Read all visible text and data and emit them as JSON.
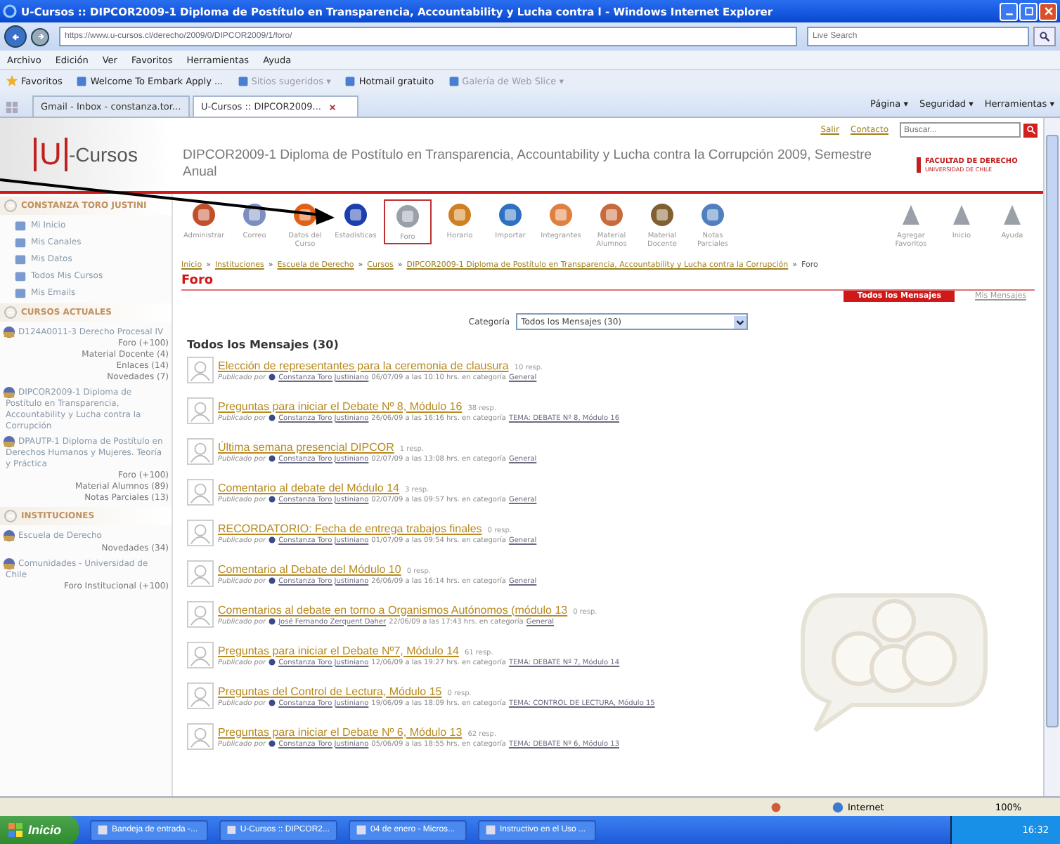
{
  "window": {
    "title": "U-Cursos :: DIPCOR2009-1 Diploma de Postítulo en Transparencia, Accountability y Lucha contra l - Windows Internet Explorer"
  },
  "browser": {
    "address": "https://www.u-cursos.cl/derecho/2009/0/DIPCOR2009/1/foro/",
    "search_placeholder": "Live Search",
    "menu": [
      "Archivo",
      "Edición",
      "Ver",
      "Favoritos",
      "Herramientas",
      "Ayuda"
    ],
    "favorites_label": "Favoritos",
    "favorites": [
      "Welcome To Embark Apply ...",
      "Sitios sugeridos ▾",
      "Hotmail gratuito",
      "Galería de Web Slice ▾"
    ],
    "tabs": [
      {
        "label": "Gmail - Inbox - constanza.tor...",
        "selected": false
      },
      {
        "label": "U-Cursos :: DIPCOR2009...",
        "selected": true
      }
    ],
    "commands": [
      "Página ▾",
      "Seguridad ▾",
      "Herramientas ▾"
    ]
  },
  "header": {
    "logo_letter": "U",
    "logo_text": "-Cursos",
    "links": [
      "Salir",
      "Contacto"
    ],
    "search_placeholder": "Buscar...",
    "course_title": "DIPCOR2009-1 Diploma de Postítulo en Transparencia, Accountability y Lucha contra la Corrupción 2009, Semestre Anual",
    "faculty": "FACULTAD DE DERECHO",
    "university": "UNIVERSIDAD DE CHILE"
  },
  "sidebar": {
    "sections": [
      {
        "title": "CONSTANZA TORO JUSTINI",
        "items": [
          {
            "kind": "link",
            "label": "Mi Inicio"
          },
          {
            "kind": "link",
            "label": "Mis Canales"
          },
          {
            "kind": "link",
            "label": "Mis Datos"
          },
          {
            "kind": "link",
            "label": "Todos Mis Cursos"
          },
          {
            "kind": "link",
            "label": "Mis Emails"
          }
        ]
      },
      {
        "title": "CURSOS ACTUALES",
        "items": [
          {
            "kind": "course",
            "label": "D124A0011-3 Derecho Procesal IV"
          },
          {
            "kind": "sub",
            "label": "Foro (+100)"
          },
          {
            "kind": "sub",
            "label": "Material Docente (4)"
          },
          {
            "kind": "sub",
            "label": "Enlaces (14)"
          },
          {
            "kind": "sub",
            "label": "Novedades (7)"
          },
          {
            "kind": "course",
            "label": "DIPCOR2009-1 Diploma de Postítulo en Transparencia, Accountability y Lucha contra la Corrupción"
          },
          {
            "kind": "course",
            "label": "DPAUTP-1 Diploma de Postítulo en Derechos Humanos y Mujeres. Teoría y Práctica"
          },
          {
            "kind": "sub",
            "label": "Foro (+100)"
          },
          {
            "kind": "sub",
            "label": "Material Alumnos (89)"
          },
          {
            "kind": "sub",
            "label": "Notas Parciales (13)"
          }
        ]
      },
      {
        "title": "INSTITUCIONES",
        "items": [
          {
            "kind": "course",
            "label": "Escuela de Derecho"
          },
          {
            "kind": "sub",
            "label": "Novedades (34)"
          },
          {
            "kind": "course",
            "label": "Comunidades - Universidad de Chile"
          },
          {
            "kind": "sub",
            "label": "Foro Institucional (+100)"
          }
        ]
      }
    ]
  },
  "tools": [
    {
      "label": "Administrar",
      "selected": false
    },
    {
      "label": "Correo",
      "selected": false
    },
    {
      "label": "Datos del Curso",
      "selected": false
    },
    {
      "label": "Estadísticas",
      "selected": false
    },
    {
      "label": "Foro",
      "selected": true
    },
    {
      "label": "Horario",
      "selected": false
    },
    {
      "label": "Importar",
      "selected": false
    },
    {
      "label": "Integrantes",
      "selected": false
    },
    {
      "label": "Material Alumnos",
      "selected": false
    },
    {
      "label": "Material Docente",
      "selected": false
    },
    {
      "label": "Notas Parciales",
      "selected": false
    }
  ],
  "right_tools": [
    "Agregar Favoritos",
    "Inicio",
    "Ayuda"
  ],
  "breadcrumb": {
    "separator": "»",
    "links": [
      "Inicio",
      "Instituciones",
      "Escuela de Derecho",
      "Cursos",
      "DIPCOR2009-1 Diploma de Postítulo en Transparencia, Accountability y Lucha contra la Corrupción"
    ],
    "current": "Foro"
  },
  "forum": {
    "title": "Foro",
    "tabs": [
      {
        "label": "Todos los Mensajes",
        "selected": true
      },
      {
        "label": "Mis Mensajes",
        "selected": false
      }
    ],
    "category_label": "Categoría",
    "category_value": "Todos los Mensajes (30)",
    "heading": "Todos los Mensajes (30)",
    "posts": [
      {
        "title": "Elección de representantes para la ceremonia de clausura",
        "replies": "10 resp.",
        "by": "Publicado por",
        "author": "Constanza Toro Justiniano",
        "when": "06/07/09 a las 10:10 hrs. en categoría",
        "category": "General"
      },
      {
        "title": "Preguntas para iniciar el Debate Nº 8, Módulo 16",
        "replies": "38 resp.",
        "by": "Publicado por",
        "author": "Constanza Toro Justiniano",
        "when": "26/06/09 a las 16:16 hrs. en categoría",
        "category": "TEMA: DEBATE Nº 8, Módulo 16"
      },
      {
        "title": "Última semana presencial DIPCOR",
        "replies": "1 resp.",
        "by": "Publicado por",
        "author": "Constanza Toro Justiniano",
        "when": "02/07/09 a las 13:08 hrs. en categoría",
        "category": "General"
      },
      {
        "title": "Comentario al debate del Módulo 14",
        "replies": "3 resp.",
        "by": "Publicado por",
        "author": "Constanza Toro Justiniano",
        "when": "02/07/09 a las 09:57 hrs. en categoría",
        "category": "General"
      },
      {
        "title": "RECORDATORIO: Fecha de entrega trabajos finales",
        "replies": "0 resp.",
        "by": "Publicado por",
        "author": "Constanza Toro Justiniano",
        "when": "01/07/09 a las 09:54 hrs. en categoría",
        "category": "General"
      },
      {
        "title": "Comentario al Debate del Módulo 10",
        "replies": "0 resp.",
        "by": "Publicado por",
        "author": "Constanza Toro Justiniano",
        "when": "26/06/09 a las 16:14 hrs. en categoría",
        "category": "General"
      },
      {
        "title": "Comentarios al debate en torno a Organismos Autónomos (módulo 13",
        "replies": "0 resp.",
        "by": "Publicado por",
        "author": "José Fernando Zerquent Daher",
        "when": "22/06/09 a las 17:43 hrs. en categoría",
        "category": "General"
      },
      {
        "title": "Preguntas para iniciar el Debate Nº7, Módulo 14",
        "replies": "61 resp.",
        "by": "Publicado por",
        "author": "Constanza Toro Justiniano",
        "when": "12/06/09 a las 19:27 hrs. en categoría",
        "category": "TEMA: DEBATE Nº 7, Módulo 14"
      },
      {
        "title": "Preguntas del Control de Lectura, Módulo 15",
        "replies": "0 resp.",
        "by": "Publicado por",
        "author": "Constanza Toro Justiniano",
        "when": "19/06/09 a las 18:09 hrs. en categoría",
        "category": "TEMA: CONTROL DE LECTURA, Módulo 15"
      },
      {
        "title": "Preguntas para iniciar el Debate Nº 6, Módulo 13",
        "replies": "62 resp.",
        "by": "Publicado por",
        "author": "Constanza Toro Justiniano",
        "when": "05/06/09 a las 18:55 hrs. en categoría",
        "category": "TEMA: DEBATE Nº 6, Módulo 13"
      }
    ]
  },
  "status_bar": {
    "zone": "Internet",
    "zoom": "100%"
  },
  "taskbar": {
    "start": "Inicio",
    "tasks": [
      "Bandeja de entrada -...",
      "U-Cursos :: DIPCOR2...",
      "04 de enero - Micros...",
      "Instructivo en el Uso ..."
    ],
    "clock": "16:32"
  }
}
